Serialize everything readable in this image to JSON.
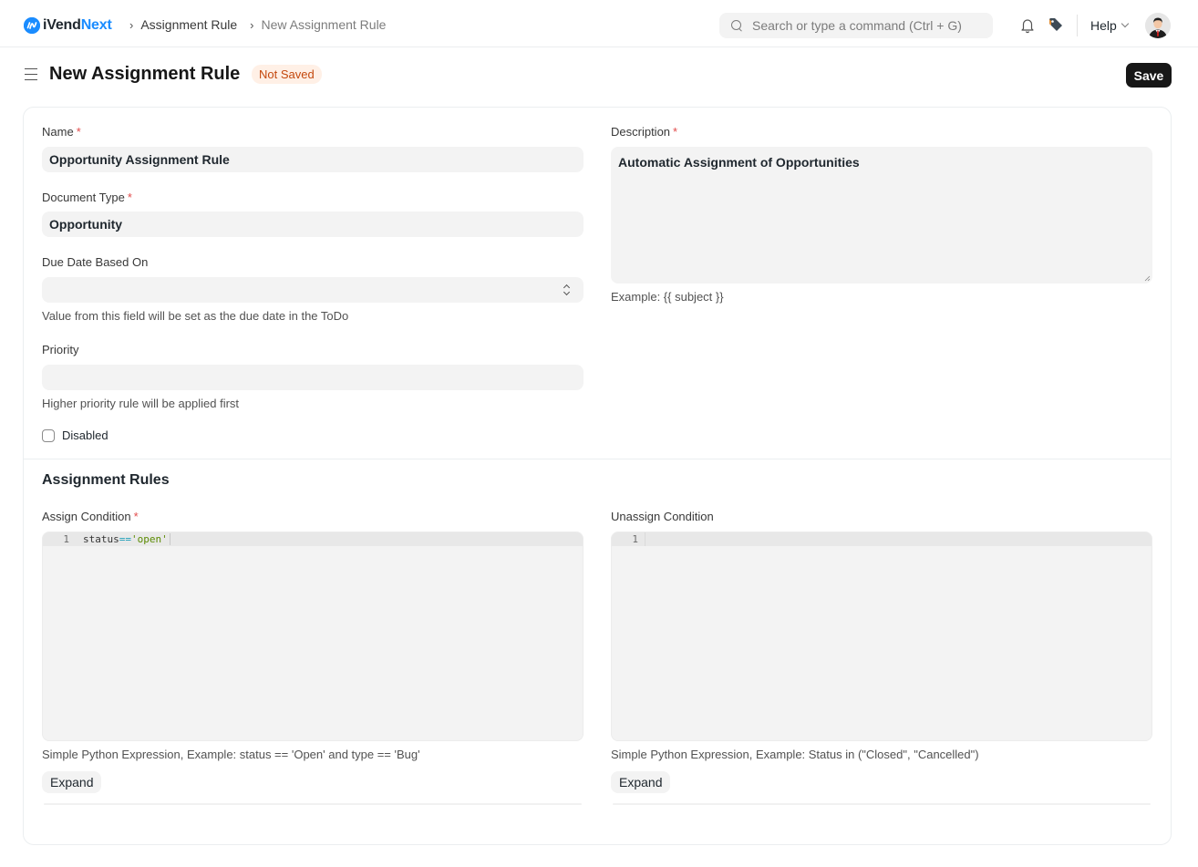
{
  "navbar": {
    "brand_prefix": "iVend",
    "brand_suffix": "Next",
    "breadcrumbs": [
      "Assignment Rule",
      "New Assignment Rule"
    ],
    "search_placeholder": "Search or type a command (Ctrl + G)",
    "help_label": "Help",
    "icons": [
      "search-icon",
      "bell-icon",
      "tag-icon",
      "chevron-down-icon",
      "avatar"
    ]
  },
  "page": {
    "title": "New Assignment Rule",
    "status": "Not Saved",
    "save_label": "Save"
  },
  "form": {
    "name": {
      "label": "Name",
      "required": "*",
      "value": "Opportunity Assignment Rule"
    },
    "document_type": {
      "label": "Document Type",
      "required": "*",
      "value": "Opportunity"
    },
    "due_date_based_on": {
      "label": "Due Date Based On",
      "value": "",
      "help": "Value from this field will be set as the due date in the ToDo"
    },
    "priority": {
      "label": "Priority",
      "value": "",
      "help": "Higher priority rule will be applied first"
    },
    "disabled": {
      "label": "Disabled",
      "checked": false
    },
    "description": {
      "label": "Description",
      "required": "*",
      "value": "Automatic Assignment of Opportunities",
      "help": "Example: {{ subject }}"
    }
  },
  "assignment_rules": {
    "title": "Assignment Rules",
    "assign_condition": {
      "label": "Assign Condition",
      "required": "*",
      "line_number": "1",
      "code_parts": {
        "ident": "status",
        "op": "==",
        "str": "'open'"
      },
      "help": "Simple Python Expression, Example: status == 'Open' and type == 'Bug'",
      "expand_label": "Expand"
    },
    "unassign_condition": {
      "label": "Unassign Condition",
      "line_number": "1",
      "code": "",
      "help": "Simple Python Expression, Example: Status in (\"Closed\", \"Cancelled\")",
      "expand_label": "Expand"
    }
  },
  "colors": {
    "brand": "#1a8cff",
    "status_badge_bg": "#fff0e6",
    "status_badge_text": "#c4480d",
    "primary_button": "#171717",
    "required": "#e24c4c"
  }
}
